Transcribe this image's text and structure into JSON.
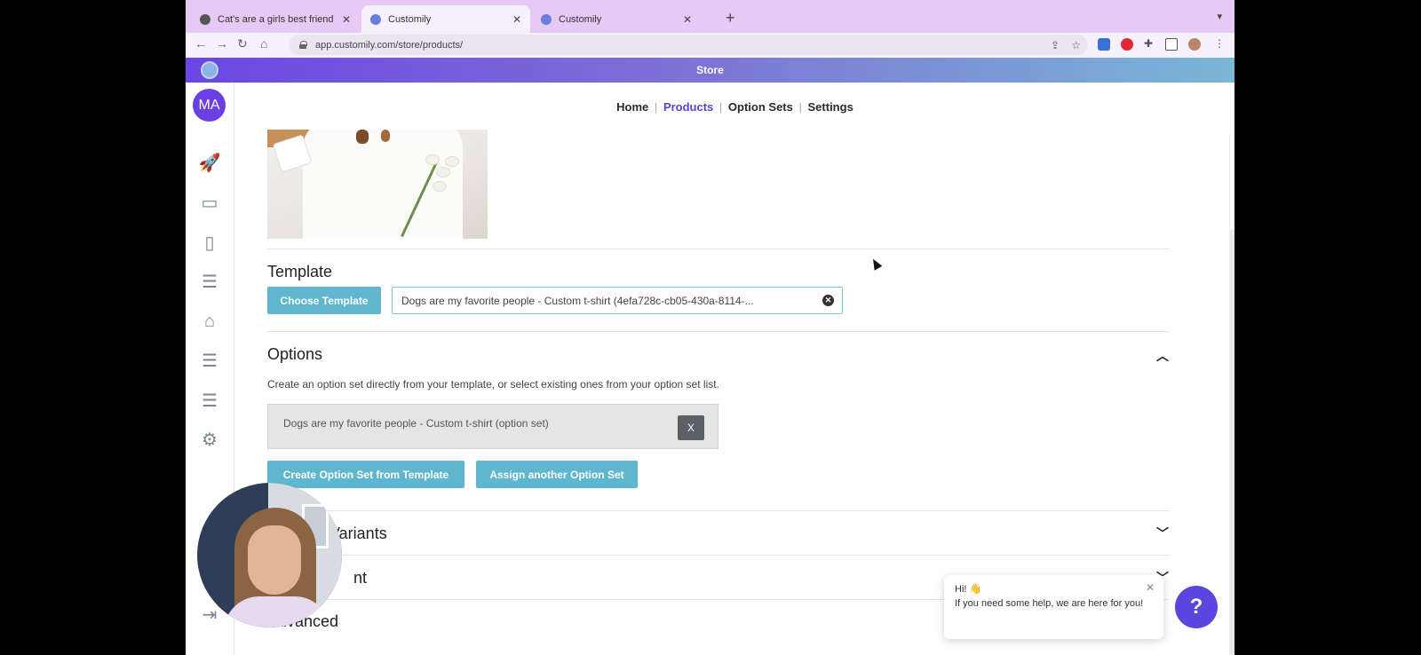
{
  "browser": {
    "tabs": [
      {
        "title": "Cat's are a girls best friend - C",
        "active": false
      },
      {
        "title": "Customily",
        "active": true
      },
      {
        "title": "Customily",
        "active": false
      }
    ],
    "new_tab": "+",
    "url": "app.customily.com/store/products/"
  },
  "app": {
    "header_title": "Store",
    "user_initials": "MA"
  },
  "nav": {
    "home": "Home",
    "products": "Products",
    "option_sets": "Option Sets",
    "settings": "Settings",
    "separator": "|"
  },
  "template": {
    "title": "Template",
    "choose_button": "Choose Template",
    "selected_value": "Dogs are my favorite people - Custom t-shirt (4efa728c-cb05-430a-8114-..."
  },
  "options": {
    "title": "Options",
    "help": "Create an option set directly from your template, or select existing ones from your option set list.",
    "assigned_set": "Dogs are my favorite people - Custom t-shirt (option set)",
    "remove_label": "X",
    "create_button": "Create Option Set from Template",
    "assign_button": "Assign another Option Set"
  },
  "sections": {
    "variants": "Variants",
    "third_partial": "nt",
    "advanced": "Advanced"
  },
  "chat": {
    "greeting": "Hi! 👋",
    "message": "If you need some help, we are here for you!",
    "help_button": "?"
  },
  "colors": {
    "accent": "#5b3fd3",
    "teal_button": "#5fb7cf",
    "tab_strip": "#e6c9f5"
  }
}
